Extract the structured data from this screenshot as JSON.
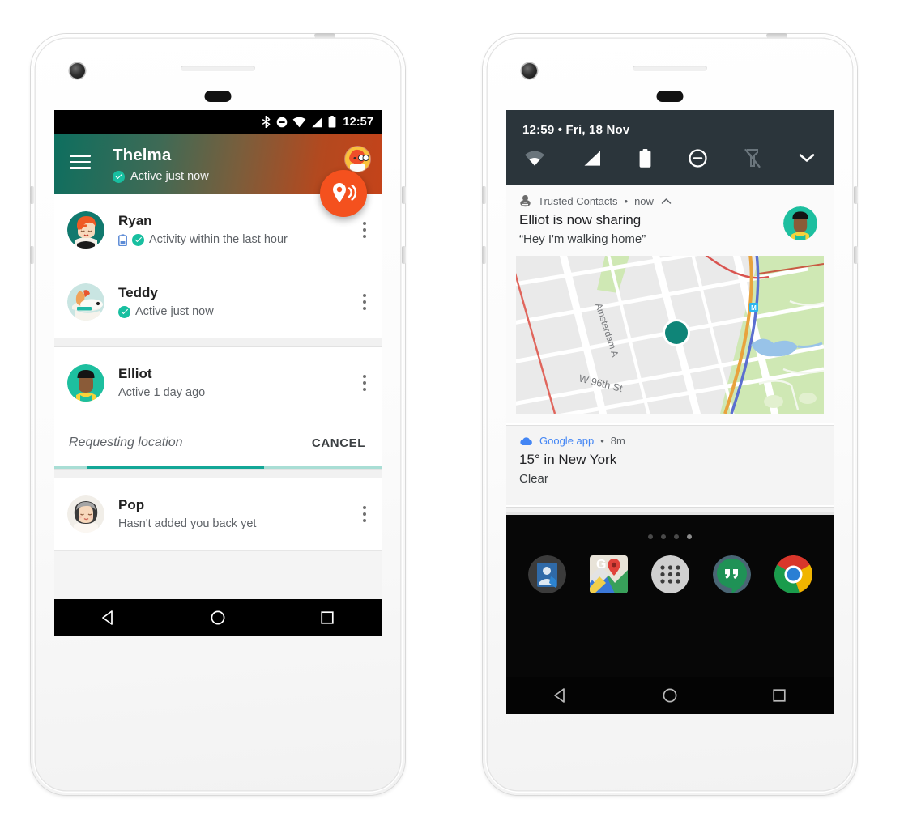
{
  "left_phone": {
    "statusbar": {
      "time": "12:57",
      "icons": [
        "bluetooth-icon",
        "do-not-disturb-icon",
        "wifi-icon",
        "cellular-icon",
        "battery-icon"
      ]
    },
    "appbar": {
      "menu_icon": "hamburger-menu-icon",
      "title": "Thelma",
      "status": "Active just now",
      "status_icon": "verified-check-icon",
      "avatar": "user-avatar",
      "fab_icon": "location-share-icon",
      "gradient_from": "#0d6f5f",
      "gradient_to": "#c4431a"
    },
    "contacts": [
      {
        "name": "Ryan",
        "status": "Activity within the last hour",
        "has_battery_icon": true,
        "has_check_icon": true,
        "avatar": "ryan-avatar"
      },
      {
        "name": "Teddy",
        "status": "Active just now",
        "has_battery_icon": false,
        "has_check_icon": true,
        "avatar": "teddy-avatar"
      },
      {
        "name": "Elliot",
        "status": "Active 1 day ago",
        "has_battery_icon": false,
        "has_check_icon": false,
        "avatar": "elliot-avatar"
      },
      {
        "name": "Pop",
        "status": "Hasn't added you back yet",
        "has_battery_icon": false,
        "has_check_icon": false,
        "avatar": "pop-avatar"
      }
    ],
    "request_strip": {
      "label": "Requesting location",
      "cancel_label": "CANCEL",
      "progress_color": "#13a797",
      "progress_track_color": "#a9ded5"
    },
    "navbar": {
      "back": "back-nav-icon",
      "home": "home-nav-icon",
      "recents": "recents-nav-icon"
    }
  },
  "right_phone": {
    "quick_settings": {
      "time_date": "12:59 • Fri, 18 Nov",
      "tiles": [
        "wifi-tile",
        "cellular-tile",
        "battery-tile",
        "do-not-disturb-tile",
        "flashlight-off-tile",
        "expand-chevron-tile"
      ],
      "background": "#2b353b"
    },
    "notifications": [
      {
        "app": "Trusted Contacts",
        "app_icon": "trusted-contacts-icon",
        "time": "now",
        "collapse_icon": "chevron-up-icon",
        "title": "Elliot is now sharing",
        "body": "“Hey I'm walking home”",
        "avatar": "elliot-avatar",
        "map": {
          "street_labels": [
            "Amsterdam A",
            "W 96th St"
          ],
          "transit_icon": "subway-station-icon",
          "marker": "location-marker",
          "marker_color": "#0f8578"
        }
      },
      {
        "app": "Google app",
        "app_icon": "weather-cloud-icon",
        "time": "8m",
        "title": "15° in New York",
        "body": "Clear"
      }
    ],
    "home_screen": {
      "page_dots": 4,
      "active_dot": 4,
      "dock": [
        "phone-contacts-icon",
        "google-maps-icon",
        "app-drawer-icon",
        "hangouts-icon",
        "chrome-icon"
      ]
    },
    "navbar": {
      "back": "back-nav-icon",
      "home": "home-nav-icon",
      "recents": "recents-nav-icon"
    }
  }
}
